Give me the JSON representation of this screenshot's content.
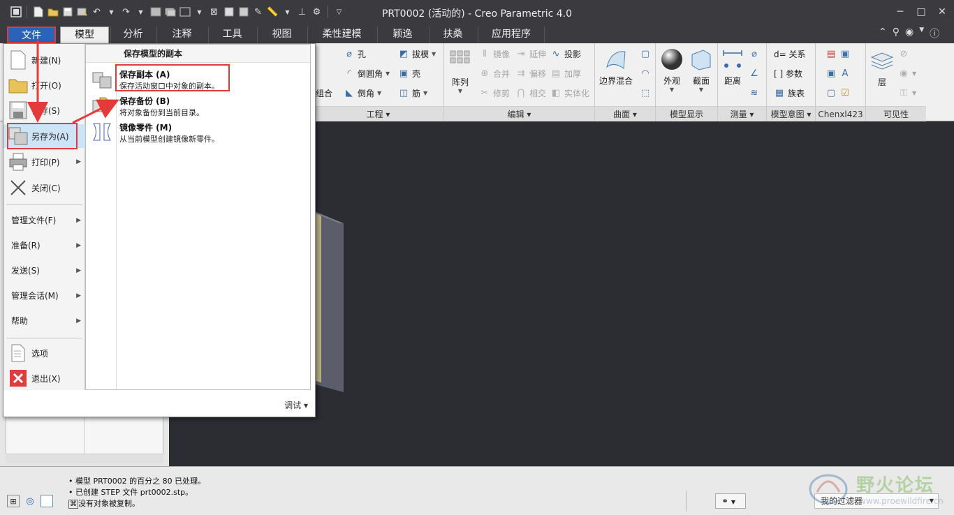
{
  "window": {
    "title": "PRT0002 (活动的) - Creo Parametric 4.0",
    "minimize": "─",
    "maximize": "□",
    "close": "✕"
  },
  "tabs": [
    "文件",
    "模型",
    "分析",
    "注释",
    "工具",
    "视图",
    "柔性建模",
    "颖逸",
    "扶桑",
    "应用程序"
  ],
  "ribbon": {
    "engineering": {
      "group": "工程",
      "items": [
        "孔",
        "拔模",
        "倒圆角",
        "壳",
        "倒角",
        "筋"
      ],
      "cut_label": "倒角",
      "combine_label": "组合"
    },
    "pattern": {
      "label": "阵列"
    },
    "edit": {
      "group": "编辑",
      "items": [
        "镜像",
        "延伸",
        "投影",
        "合并",
        "偏移",
        "加厚",
        "修剪",
        "相交",
        "实体化"
      ]
    },
    "surface": {
      "group": "曲面",
      "boundary_blend": "边界混合"
    },
    "display": {
      "group": "模型显示",
      "appearance": "外观",
      "section": "截面"
    },
    "measure": {
      "group": "测量",
      "distance": "距离"
    },
    "intent": {
      "group": "模型意图",
      "relations": "d= 关系",
      "params": "[ ] 参数",
      "family": "族表"
    },
    "custom": {
      "group": "Chenxl423"
    },
    "visibility": {
      "group": "可见性",
      "layer": "层"
    }
  },
  "filemenu": {
    "items": [
      {
        "label": "新建(N)"
      },
      {
        "label": "打开(O)"
      },
      {
        "label": "保存(S)"
      },
      {
        "label": "另存为(A)"
      },
      {
        "label": "打印(P)"
      },
      {
        "label": "关闭(C)"
      }
    ],
    "subs": [
      {
        "label": "管理文件(F)"
      },
      {
        "label": "准备(R)"
      },
      {
        "label": "发送(S)"
      },
      {
        "label": "管理会话(M)"
      },
      {
        "label": "帮助"
      }
    ],
    "options": "选项",
    "exit": "退出(X)",
    "panel_title": "保存模型的副本",
    "opts": [
      {
        "title": "保存副本 (A)",
        "desc": "保存活动窗口中对象的副本。"
      },
      {
        "title": "保存备份 (B)",
        "desc": "将对象备份到当前目录。"
      },
      {
        "title": "镜像零件 (M)",
        "desc": "从当前模型创建镜像新零件。"
      }
    ],
    "debug": "调试 ▾"
  },
  "status": {
    "messages": [
      "模型 PRT0002 的百分之 80 已处理。",
      "已创建 STEP 文件 prt0002.stp。",
      "没有对象被复制。"
    ],
    "filter": "我的过滤器"
  },
  "watermark": {
    "name": "野火论坛",
    "url": "www.proewildfire.cn"
  },
  "colors": {
    "accent": "#2a63b8",
    "highlight": "#e43a3a",
    "viewport": "#2c2c33"
  }
}
